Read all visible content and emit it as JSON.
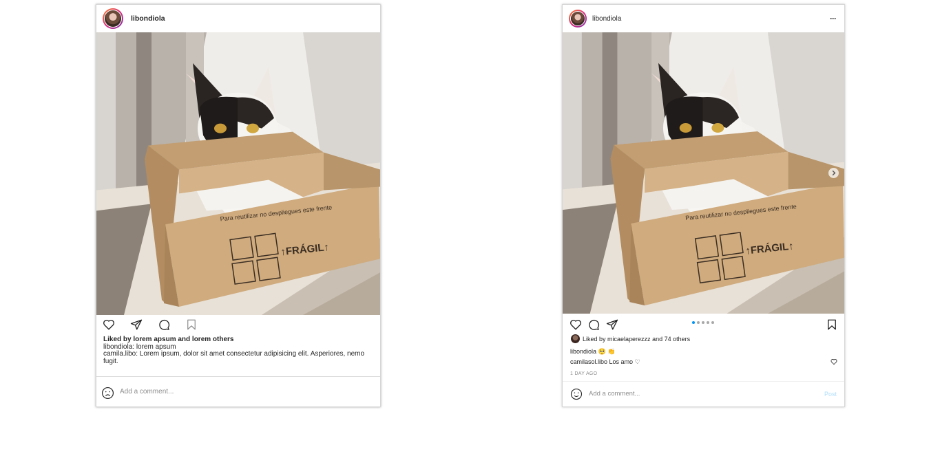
{
  "left_post": {
    "username": "libondiola",
    "likes_text": "Liked by lorem apsum and lorem others",
    "caption": "libondiola: lorem apsum",
    "comment": "camila.libo: Lorem ipsum, dolor sit amet consectetur adipisicing elit. Asperiores, nemo fugit.",
    "comment_placeholder": "Add a comment..."
  },
  "right_post": {
    "username": "libondiola",
    "more_label": "···",
    "likes_prefix": "Liked by ",
    "likes_user": "micaelaperezzz",
    "likes_suffix": " and 74 others",
    "caption_user": "libondiola",
    "caption_emoji": "🥺 👏",
    "comment_user": "camilasol.libo",
    "comment_text": "Los amo ♡",
    "timestamp": "1 DAY AGO",
    "comment_placeholder": "Add a comment...",
    "post_label": "Post",
    "carousel": {
      "count": 5,
      "active": 1
    }
  },
  "colors": {
    "accent": "#0095f6",
    "post_disabled": "#b2dffc",
    "text": "#262626",
    "muted": "#8e8e8e"
  },
  "icons": [
    "heart-icon",
    "send-icon",
    "comment-icon",
    "bookmark-icon",
    "emoji-icon",
    "chevron-right-icon",
    "more-icon"
  ]
}
